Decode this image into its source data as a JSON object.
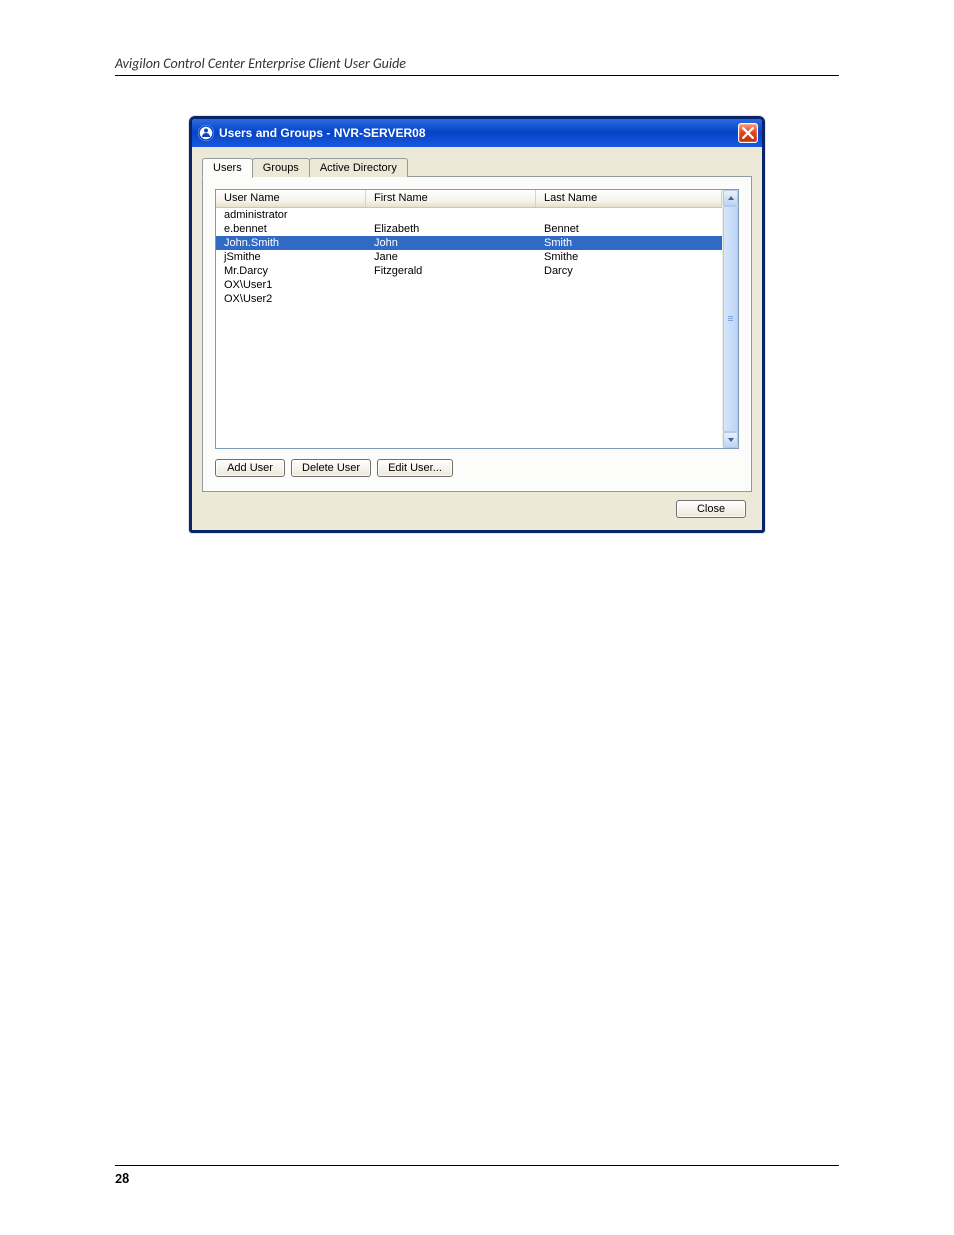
{
  "doc_header": "Avigilon Control Center Enterprise Client User Guide",
  "page_number": "28",
  "dialog": {
    "title": "Users and Groups - NVR-SERVER08",
    "tabs": {
      "users": "Users",
      "groups": "Groups",
      "ad": "Active Directory"
    },
    "columns": {
      "username": "User Name",
      "firstname": "First Name",
      "lastname": "Last Name"
    },
    "rows": [
      {
        "user": "administrator",
        "first": "",
        "last": ""
      },
      {
        "user": "e.bennet",
        "first": "Elizabeth",
        "last": "Bennet"
      },
      {
        "user": "John.Smith",
        "first": "John",
        "last": "Smith"
      },
      {
        "user": "jSmithe",
        "first": "Jane",
        "last": "Smithe"
      },
      {
        "user": "Mr.Darcy",
        "first": "Fitzgerald",
        "last": "Darcy"
      },
      {
        "user": "OX\\User1",
        "first": "",
        "last": ""
      },
      {
        "user": "OX\\User2",
        "first": "",
        "last": ""
      }
    ],
    "selected_index": 2,
    "buttons": {
      "add": "Add User",
      "delete": "Delete User",
      "edit": "Edit User...",
      "close": "Close"
    }
  }
}
